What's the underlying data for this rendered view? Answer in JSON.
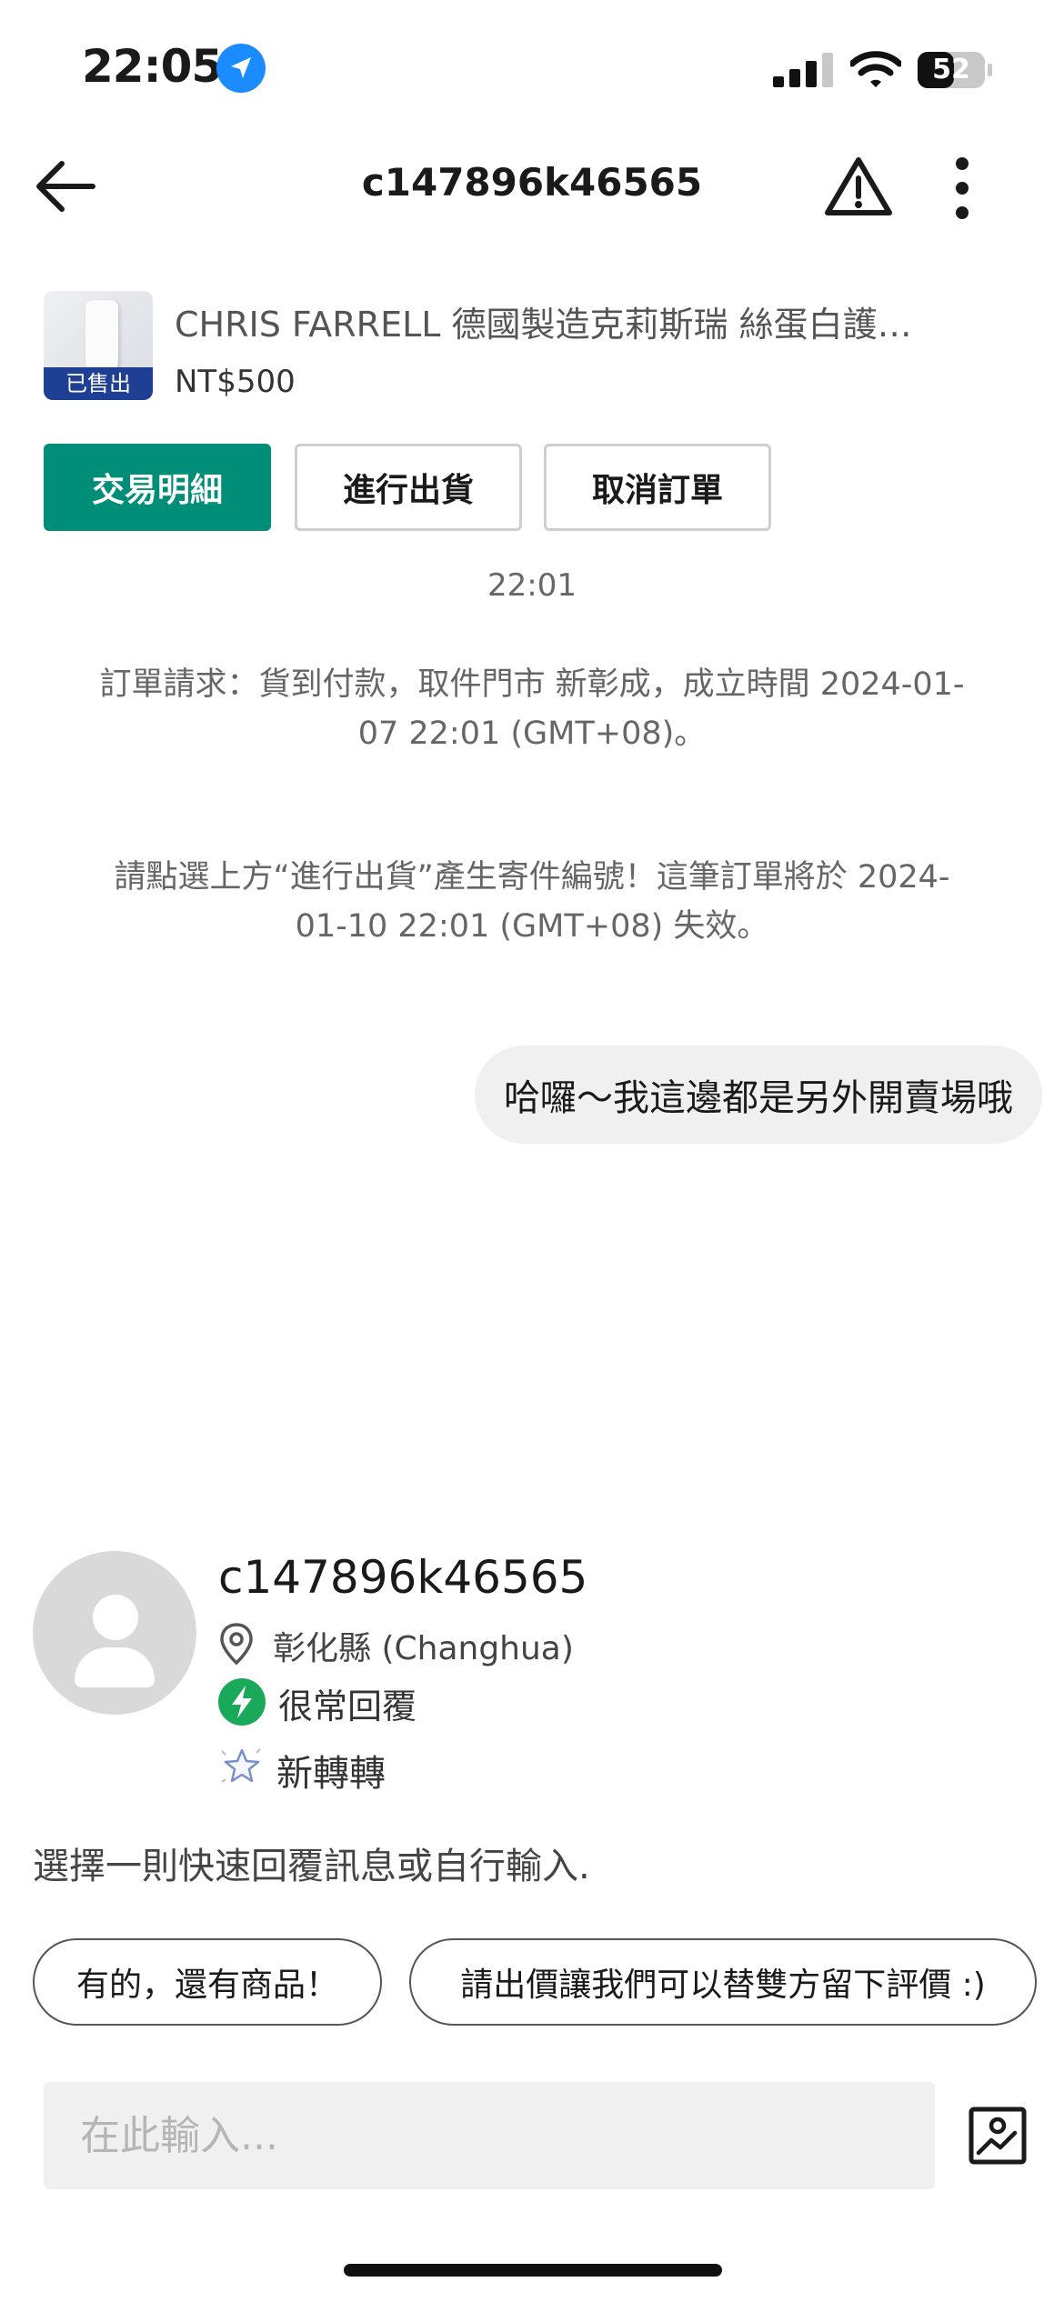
{
  "status_bar": {
    "time": "22:05",
    "battery": "52",
    "icons": [
      "location-arrow-icon",
      "signal-icon",
      "wifi-icon",
      "battery-icon"
    ]
  },
  "header": {
    "title": "c147896k46565",
    "icons": [
      "back-arrow-icon",
      "warning-icon",
      "more-vertical-icon"
    ]
  },
  "product": {
    "title": "CHRIS FARRELL 德國製造克莉斯瑞 絲蛋白護…",
    "price": "NT$500",
    "badge": "已售出"
  },
  "actions": {
    "details": "交易明細",
    "ship": "進行出貨",
    "cancel": "取消訂單"
  },
  "chat": {
    "time": "22:01",
    "system_messages": [
      "訂單請求：貨到付款，取件門市 新彰成，成立時間 2024-01-07 22:01 (GMT+08)。",
      "請點選上方“進行出貨”產生寄件編號！這筆訂單將於 2024-01-10 22:01 (GMT+08) 失效。"
    ],
    "my_message": "哈囉～我這邊都是另外開賣場哦"
  },
  "profile": {
    "name": "c147896k46565",
    "location": "彰化縣 (Changhua)",
    "reply_rate": "很常回覆",
    "level": "新轉轉"
  },
  "quick_reply": {
    "prompt": "選擇一則快速回覆訊息或自行輸入.",
    "chips": [
      "有的，還有商品！",
      "請出價讓我們可以替雙方留下評價 :)"
    ]
  },
  "composer": {
    "placeholder": "在此輸入..."
  },
  "colors": {
    "primary": "#008e78",
    "sold_badge": "#1e3f93",
    "bolt": "#1aa85a"
  }
}
